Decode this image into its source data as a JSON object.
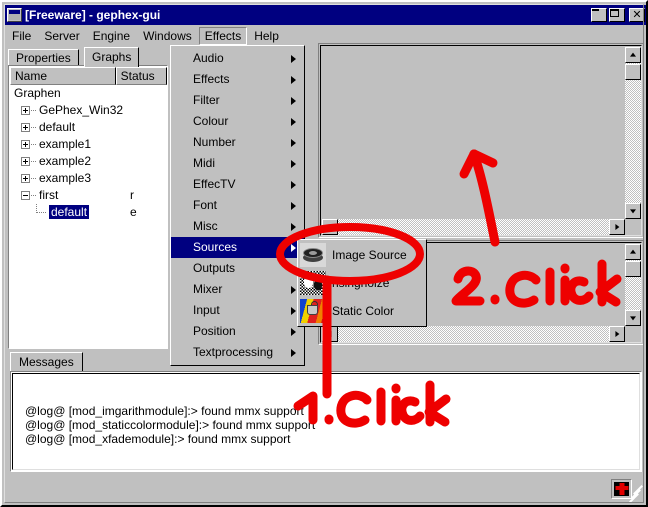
{
  "window": {
    "title": "[Freeware] - gephex-gui",
    "icon": "window-icon",
    "buttons": {
      "minimize": "_",
      "maximize": "□",
      "close": "✕"
    }
  },
  "menubar": {
    "items": [
      {
        "label": "File",
        "open": false
      },
      {
        "label": "Server",
        "open": false
      },
      {
        "label": "Engine",
        "open": false
      },
      {
        "label": "Windows",
        "open": false
      },
      {
        "label": "Effects",
        "open": true
      },
      {
        "label": "Help",
        "open": false
      }
    ]
  },
  "tabs": [
    {
      "label": "Properties",
      "active": false
    },
    {
      "label": "Graphs",
      "active": true
    }
  ],
  "tree": {
    "columns": [
      "Name",
      "Status"
    ],
    "rows": [
      {
        "label": "Graphen",
        "indent": 0,
        "toggle": "none",
        "selected": false,
        "status": ""
      },
      {
        "label": "GePhex_Win32",
        "indent": 1,
        "toggle": "plus",
        "selected": false,
        "status": ""
      },
      {
        "label": "default",
        "indent": 1,
        "toggle": "plus",
        "selected": false,
        "status": ""
      },
      {
        "label": "example1",
        "indent": 1,
        "toggle": "plus",
        "selected": false,
        "status": ""
      },
      {
        "label": "example2",
        "indent": 1,
        "toggle": "plus",
        "selected": false,
        "status": ""
      },
      {
        "label": "example3",
        "indent": 1,
        "toggle": "plus",
        "selected": false,
        "status": ""
      },
      {
        "label": "first",
        "indent": 1,
        "toggle": "minus",
        "selected": false,
        "status": "r"
      },
      {
        "label": "default",
        "indent": 2,
        "toggle": "none",
        "selected": true,
        "status": "e"
      }
    ]
  },
  "dropdown": {
    "items": [
      {
        "label": "Audio",
        "submenu": true,
        "highlight": false
      },
      {
        "label": "Effects",
        "submenu": true,
        "highlight": false
      },
      {
        "label": "Filter",
        "submenu": true,
        "highlight": false
      },
      {
        "label": "Colour",
        "submenu": true,
        "highlight": false
      },
      {
        "label": "Number",
        "submenu": true,
        "highlight": false
      },
      {
        "label": "Midi",
        "submenu": true,
        "highlight": false
      },
      {
        "label": "EffecTV",
        "submenu": true,
        "highlight": false
      },
      {
        "label": "Font",
        "submenu": true,
        "highlight": false
      },
      {
        "label": "Misc",
        "submenu": true,
        "highlight": false
      },
      {
        "label": "Sources",
        "submenu": true,
        "highlight": true
      },
      {
        "label": "Outputs",
        "submenu": false,
        "highlight": false
      },
      {
        "label": "Mixer",
        "submenu": true,
        "highlight": false
      },
      {
        "label": "Input",
        "submenu": true,
        "highlight": false
      },
      {
        "label": "Position",
        "submenu": true,
        "highlight": false
      },
      {
        "label": "Textprocessing",
        "submenu": true,
        "highlight": false
      }
    ]
  },
  "submenu": {
    "items": [
      {
        "label": "Image Source",
        "icon": "film-reel-icon"
      },
      {
        "label": "risingnoize",
        "icon": "noise-icon"
      },
      {
        "label": "Static Color",
        "icon": "color-gradient-icon"
      }
    ]
  },
  "messages": {
    "tab_label": "Messages",
    "lines": [
      "@log@ [mod_imgarithmodule]:> found mmx support",
      "@log@ [mod_staticcolormodule]:> found mmx support",
      "@log@ [mod_xfademodule]:> found mmx support"
    ]
  },
  "statusbar": {
    "indicator": "red-cross-icon",
    "resize_grip": "resize-grip-icon"
  },
  "annotations": [
    {
      "text": "2.Click",
      "kind": "handwriting"
    },
    {
      "text": "1.Click",
      "kind": "handwriting"
    }
  ],
  "colors": {
    "titlebar": "#000080",
    "face": "#c0c0c0",
    "highlight": "#000080",
    "annotation": "#ee0000",
    "window_text": "#000000"
  }
}
